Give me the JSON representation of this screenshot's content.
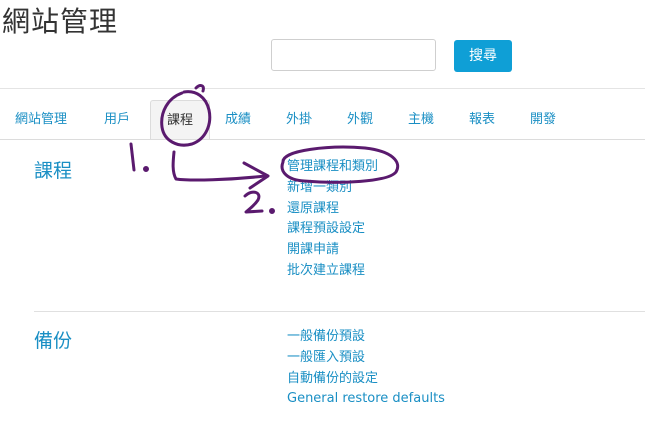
{
  "page_title": "網站管理",
  "search": {
    "value": "",
    "button_label": "搜尋"
  },
  "tabs": [
    {
      "label": "網站管理"
    },
    {
      "label": "用戶"
    },
    {
      "label": "課程"
    },
    {
      "label": "成績"
    },
    {
      "label": "外掛"
    },
    {
      "label": "外觀"
    },
    {
      "label": "主機"
    },
    {
      "label": "報表"
    },
    {
      "label": "開發"
    }
  ],
  "active_tab": "課程",
  "sections": [
    {
      "heading": "課程",
      "links": [
        "管理課程和類別",
        "新增一類別",
        "還原課程",
        "課程預設設定",
        "開課申請",
        "批次建立課程"
      ]
    },
    {
      "heading": "備份",
      "links": [
        "一般備份預設",
        "一般匯入預設",
        "自動備份的設定",
        "General restore defaults"
      ]
    }
  ],
  "annotations": {
    "label_1": "1.",
    "label_2": "2.",
    "color": "#5a1a6e"
  },
  "colors": {
    "accent": "#1a8fc4",
    "button": "#0f9fd6"
  }
}
